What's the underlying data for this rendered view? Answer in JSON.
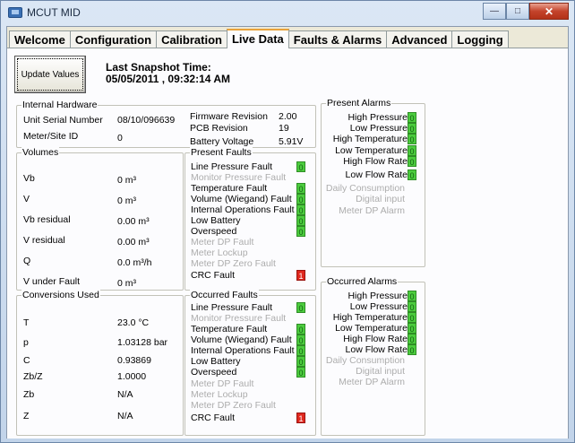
{
  "window": {
    "title": "MCUT MID",
    "minimize": "—",
    "maximize": "□",
    "close": "✕"
  },
  "tabs": [
    "Welcome",
    "Configuration",
    "Calibration",
    "Live Data",
    "Faults & Alarms",
    "Advanced",
    "Logging"
  ],
  "update_button": "Update Values",
  "snapshot": {
    "label": "Last Snapshot Time:",
    "value": "05/05/2011 , 09:32:14 AM"
  },
  "internal_hardware": {
    "title": "Internal Hardware",
    "serial_label": "Unit Serial Number",
    "serial_value": "08/10/096639",
    "meter_label": "Meter/Site ID",
    "meter_value": "0",
    "firmware_label": "Firmware Revision",
    "firmware_value": "2.00",
    "pcb_label": "PCB Revision",
    "pcb_value": "19",
    "battery_label": "Battery Voltage",
    "battery_value": "5.91V"
  },
  "volumes": {
    "title": "Volumes",
    "rows": [
      {
        "label": "Vb",
        "value": "0 m³"
      },
      {
        "label": "V",
        "value": "0 m³"
      },
      {
        "label": "Vb residual",
        "value": "0.00 m³"
      },
      {
        "label": "V residual",
        "value": "0.00 m³"
      },
      {
        "label": "Q",
        "value": "0.0 m³/h"
      },
      {
        "label": "V under Fault",
        "value": "0 m³"
      }
    ]
  },
  "conversions": {
    "title": "Conversions Used",
    "rows": [
      {
        "label": "T",
        "value": "23.0 °C"
      },
      {
        "label": "p",
        "value": "1.03128 bar"
      },
      {
        "label": "C",
        "value": "0.93869"
      },
      {
        "label": "Zb/Z",
        "value": "1.0000"
      },
      {
        "label": "Zb",
        "value": "N/A"
      },
      {
        "label": "Z",
        "value": "N/A"
      }
    ]
  },
  "present_faults": {
    "title": "Present Faults",
    "items": [
      {
        "label": "Line Pressure Fault",
        "state": "0"
      },
      {
        "label": "Monitor Pressure Fault"
      },
      {
        "label": "Temperature Fault",
        "state": "0"
      },
      {
        "label": "Volume (Wiegand) Fault",
        "state": "0"
      },
      {
        "label": "Internal Operations Fault",
        "state": "0"
      },
      {
        "label": "Low Battery",
        "state": "0"
      },
      {
        "label": "Overspeed",
        "state": "0"
      },
      {
        "label": "Meter DP Fault"
      },
      {
        "label": "Meter Lockup"
      },
      {
        "label": "Meter DP Zero Fault"
      },
      {
        "label": "CRC Fault",
        "state": "1"
      }
    ]
  },
  "occurred_faults": {
    "title": "Occurred Faults",
    "items": [
      {
        "label": "Line Pressure Fault",
        "state": "0"
      },
      {
        "label": "Monitor Pressure Fault"
      },
      {
        "label": "Temperature Fault",
        "state": "0"
      },
      {
        "label": "Volume (Wiegand) Fault",
        "state": "0"
      },
      {
        "label": "Internal Operations Fault",
        "state": "0"
      },
      {
        "label": "Low Battery",
        "state": "0"
      },
      {
        "label": "Overspeed",
        "state": "0"
      },
      {
        "label": "Meter DP Fault"
      },
      {
        "label": "Meter Lockup"
      },
      {
        "label": "Meter DP Zero Fault"
      },
      {
        "label": "CRC Fault",
        "state": "1"
      }
    ]
  },
  "present_alarms": {
    "title": "Present Alarms",
    "items": [
      {
        "label": "High Pressure",
        "state": "0"
      },
      {
        "label": "Low Pressure",
        "state": "0"
      },
      {
        "label": "High Temperature",
        "state": "0"
      },
      {
        "label": "Low Temperature",
        "state": "0"
      },
      {
        "label": "High Flow Rate",
        "state": "0"
      },
      {
        "label": "Low Flow Rate",
        "state": "0"
      },
      {
        "label": "Daily Consumption"
      },
      {
        "label": "Digital input"
      },
      {
        "label": "Meter DP Alarm"
      }
    ]
  },
  "occurred_alarms": {
    "title": "Occurred Alarms",
    "items": [
      {
        "label": "High Pressure",
        "state": "0"
      },
      {
        "label": "Low Pressure",
        "state": "0"
      },
      {
        "label": "High Temperature",
        "state": "0"
      },
      {
        "label": "Low Temperature",
        "state": "0"
      },
      {
        "label": "High Flow Rate",
        "state": "0"
      },
      {
        "label": "Low Flow Rate",
        "state": "0"
      },
      {
        "label": "Daily Consumption"
      },
      {
        "label": "Digital input"
      },
      {
        "label": "Meter DP Alarm"
      }
    ]
  },
  "colors": {
    "ok": "#4ccc3e",
    "fault": "#e0281e",
    "disabled": "#adadad",
    "active_tab_accent": "#e8a23a"
  }
}
